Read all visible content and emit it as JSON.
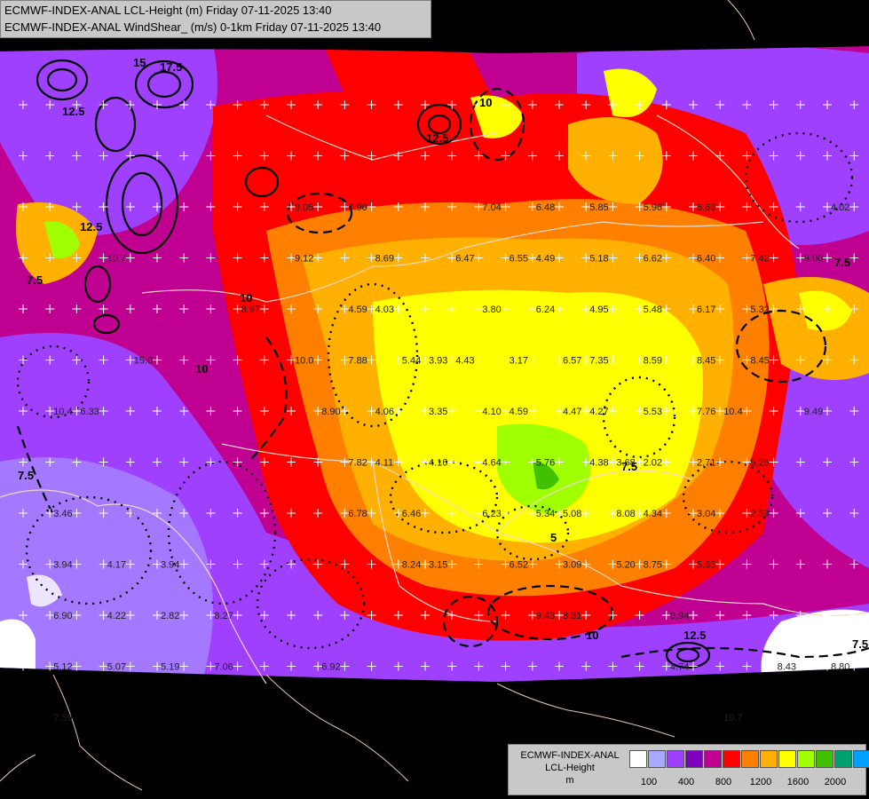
{
  "header": {
    "line1": "ECMWF-INDEX-ANAL LCL-Height (m) Friday 07-11-2025 13:40",
    "line2": "ECMWF-INDEX-ANAL WindShear_ (m/s) 0-1km Friday 07-11-2025 13:40"
  },
  "legend": {
    "title_line1": "ECMWF-INDEX-ANAL",
    "title_line2": "LCL-Height",
    "title_line3": "m",
    "colors": [
      "#ffffff",
      "#a8a8ff",
      "#a040ff",
      "#8000c0",
      "#c00090",
      "#ff0000",
      "#ff8000",
      "#ffb000",
      "#ffff00",
      "#a0ff00",
      "#40c000",
      "#00a070",
      "#00a0ff"
    ],
    "ticks": [
      "100",
      "400",
      "800",
      "1200",
      "1600",
      "2000"
    ]
  },
  "map": {
    "value_labels": [
      {
        "text": "10.7",
        "c": 3,
        "r": 3
      },
      {
        "text": "15.0",
        "c": 4,
        "r": 5
      },
      {
        "text": "6.33",
        "c": 2,
        "r": 6
      },
      {
        "text": "10.4",
        "c": 1,
        "r": 6
      },
      {
        "text": "9.05",
        "c": 10,
        "r": 2
      },
      {
        "text": "7.90",
        "c": 12,
        "r": 2
      },
      {
        "text": "7.04",
        "c": 17,
        "r": 2
      },
      {
        "text": "6.48",
        "c": 19,
        "r": 2
      },
      {
        "text": "5.85",
        "c": 21,
        "r": 2
      },
      {
        "text": "5.96",
        "c": 23,
        "r": 2
      },
      {
        "text": "6.69",
        "c": 25,
        "r": 2
      },
      {
        "text": "4.02",
        "c": 30,
        "r": 2
      },
      {
        "text": "9.12",
        "c": 10,
        "r": 3
      },
      {
        "text": "8.69",
        "c": 13,
        "r": 3
      },
      {
        "text": "6.47",
        "c": 16,
        "r": 3
      },
      {
        "text": "6.55",
        "c": 18,
        "r": 3
      },
      {
        "text": "4.49",
        "c": 19,
        "r": 3
      },
      {
        "text": "5.18",
        "c": 21,
        "r": 3
      },
      {
        "text": "6.62",
        "c": 23,
        "r": 3
      },
      {
        "text": "6.40",
        "c": 25,
        "r": 3
      },
      {
        "text": "7.42",
        "c": 27,
        "r": 3
      },
      {
        "text": "9.00",
        "c": 29,
        "r": 3
      },
      {
        "text": "8.97",
        "c": 8,
        "r": 4
      },
      {
        "text": "4.59",
        "c": 12,
        "r": 4
      },
      {
        "text": "4.03",
        "c": 13,
        "r": 4
      },
      {
        "text": "3.80",
        "c": 17,
        "r": 4
      },
      {
        "text": "6.24",
        "c": 19,
        "r": 4
      },
      {
        "text": "4.95",
        "c": 21,
        "r": 4
      },
      {
        "text": "5.48",
        "c": 23,
        "r": 4
      },
      {
        "text": "6.17",
        "c": 25,
        "r": 4
      },
      {
        "text": "5.32",
        "c": 27,
        "r": 4
      },
      {
        "text": "10.0",
        "c": 10,
        "r": 5
      },
      {
        "text": "7.88",
        "c": 12,
        "r": 5
      },
      {
        "text": "5.44",
        "c": 14,
        "r": 5
      },
      {
        "text": "3.93",
        "c": 15,
        "r": 5
      },
      {
        "text": "4.43",
        "c": 16,
        "r": 5
      },
      {
        "text": "3.17",
        "c": 18,
        "r": 5
      },
      {
        "text": "6.57",
        "c": 20,
        "r": 5
      },
      {
        "text": "7.35",
        "c": 21,
        "r": 5
      },
      {
        "text": "8.59",
        "c": 23,
        "r": 5
      },
      {
        "text": "8.45",
        "c": 25,
        "r": 5
      },
      {
        "text": "8.45",
        "c": 27,
        "r": 5
      },
      {
        "text": "8.90",
        "c": 11,
        "r": 6
      },
      {
        "text": "4.06",
        "c": 13,
        "r": 6
      },
      {
        "text": "3.35",
        "c": 15,
        "r": 6
      },
      {
        "text": "4.10",
        "c": 17,
        "r": 6
      },
      {
        "text": "4.59",
        "c": 18,
        "r": 6
      },
      {
        "text": "4.47",
        "c": 20,
        "r": 6
      },
      {
        "text": "4.27",
        "c": 21,
        "r": 6
      },
      {
        "text": "5.53",
        "c": 23,
        "r": 6
      },
      {
        "text": "7.76",
        "c": 25,
        "r": 6
      },
      {
        "text": "10.4",
        "c": 26,
        "r": 6
      },
      {
        "text": "9.49",
        "c": 29,
        "r": 6
      },
      {
        "text": "7.82",
        "c": 12,
        "r": 7
      },
      {
        "text": "4.11",
        "c": 13,
        "r": 7
      },
      {
        "text": "4.16",
        "c": 15,
        "r": 7
      },
      {
        "text": "4.64",
        "c": 17,
        "r": 7
      },
      {
        "text": "5.76",
        "c": 19,
        "r": 7
      },
      {
        "text": "4.38",
        "c": 21,
        "r": 7
      },
      {
        "text": "3.68",
        "c": 22,
        "r": 7
      },
      {
        "text": "2.02",
        "c": 23,
        "r": 7
      },
      {
        "text": "2.71",
        "c": 25,
        "r": 7
      },
      {
        "text": "5.25",
        "c": 27,
        "r": 7
      },
      {
        "text": "3.46",
        "c": 1,
        "r": 8
      },
      {
        "text": "6.78",
        "c": 12,
        "r": 8
      },
      {
        "text": "6.46",
        "c": 14,
        "r": 8
      },
      {
        "text": "6.23",
        "c": 17,
        "r": 8
      },
      {
        "text": "5.34",
        "c": 19,
        "r": 8
      },
      {
        "text": "5.08",
        "c": 20,
        "r": 8
      },
      {
        "text": "8.08",
        "c": 22,
        "r": 8
      },
      {
        "text": "4.34",
        "c": 23,
        "r": 8
      },
      {
        "text": "3.04",
        "c": 25,
        "r": 8
      },
      {
        "text": "2.59",
        "c": 27,
        "r": 8
      },
      {
        "text": "3.94",
        "c": 1,
        "r": 9
      },
      {
        "text": "4.17",
        "c": 3,
        "r": 9
      },
      {
        "text": "3.94",
        "c": 5,
        "r": 9
      },
      {
        "text": "8.24",
        "c": 14,
        "r": 9
      },
      {
        "text": "3.15",
        "c": 15,
        "r": 9
      },
      {
        "text": "6.52",
        "c": 18,
        "r": 9
      },
      {
        "text": "3.09",
        "c": 20,
        "r": 9
      },
      {
        "text": "5.20",
        "c": 22,
        "r": 9
      },
      {
        "text": "8.75",
        "c": 23,
        "r": 9
      },
      {
        "text": "5.65",
        "c": 25,
        "r": 9
      },
      {
        "text": "6.90",
        "c": 1,
        "r": 10
      },
      {
        "text": "4.22",
        "c": 3,
        "r": 10
      },
      {
        "text": "2.82",
        "c": 5,
        "r": 10
      },
      {
        "text": "8.27",
        "c": 7,
        "r": 10
      },
      {
        "text": "9.43",
        "c": 19,
        "r": 10
      },
      {
        "text": "8.31",
        "c": 20,
        "r": 10
      },
      {
        "text": "0.94",
        "c": 24,
        "r": 10
      },
      {
        "text": "5.12",
        "c": 1,
        "r": 11
      },
      {
        "text": "5.07",
        "c": 3,
        "r": 11
      },
      {
        "text": "5.19",
        "c": 5,
        "r": 11
      },
      {
        "text": "7.06",
        "c": 7,
        "r": 11
      },
      {
        "text": "6.92",
        "c": 11,
        "r": 11
      },
      {
        "text": "4.74",
        "c": 24,
        "r": 11
      },
      {
        "text": "8.43",
        "c": 28,
        "r": 11
      },
      {
        "text": "8.80",
        "c": 30,
        "r": 11
      },
      {
        "text": "7.59",
        "c": 1,
        "r": 12
      },
      {
        "text": "10.7",
        "c": 26,
        "r": 12
      }
    ],
    "contour_labels": [
      "17.5",
      "12.5",
      "15",
      "7.5",
      "12.5",
      "10",
      "7.5",
      "10",
      "12.5",
      "10",
      "7.5",
      "5",
      "12.5",
      "10",
      "7.5",
      "7.5"
    ]
  }
}
